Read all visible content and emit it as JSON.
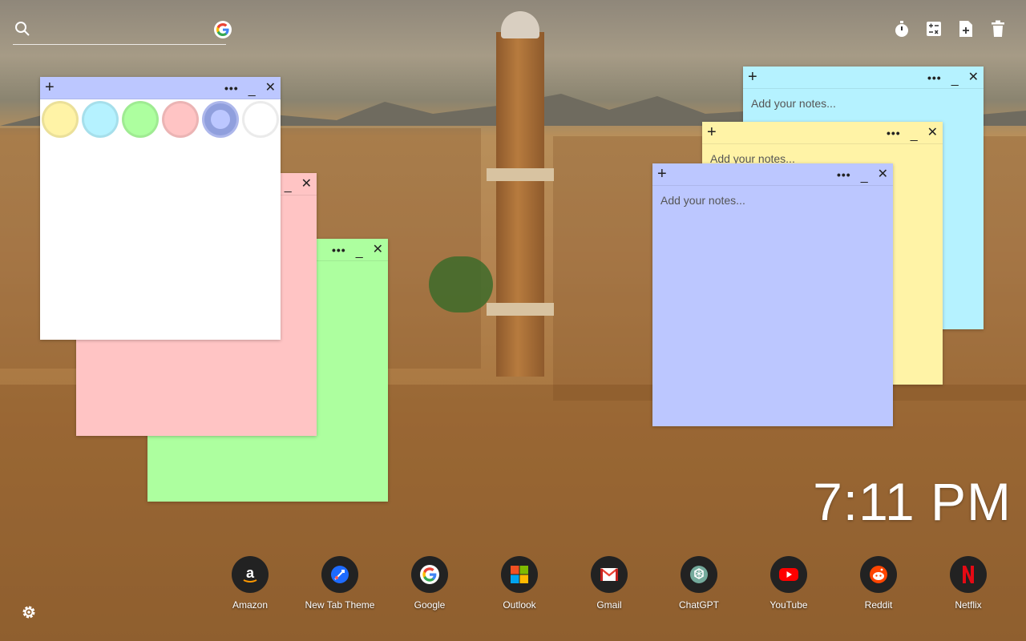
{
  "search": {
    "placeholder": ""
  },
  "tools": [
    "timer-icon",
    "calculator-icon",
    "new-document-icon",
    "trash-icon"
  ],
  "notes": {
    "placeholder": "Add your notes...",
    "plus": "+",
    "more": "•••",
    "minimize": "_",
    "close": "✕"
  },
  "swatches": [
    {
      "name": "yellow",
      "color": "#fff3a6"
    },
    {
      "name": "cyan",
      "color": "#b5f2ff"
    },
    {
      "name": "green",
      "color": "#adff9f"
    },
    {
      "name": "pink",
      "color": "#ffc4c4"
    },
    {
      "name": "blue",
      "color": "#bcc7ff"
    },
    {
      "name": "white",
      "color": "#ffffff"
    }
  ],
  "clock": {
    "time": "7:11 PM"
  },
  "dock": {
    "apps": [
      {
        "label": "Amazon",
        "icon": "amazon-icon"
      },
      {
        "label": "New Tab Theme",
        "icon": "new-tab-theme-icon"
      },
      {
        "label": "Google",
        "icon": "google-icon"
      },
      {
        "label": "Outlook",
        "icon": "outlook-icon"
      },
      {
        "label": "Gmail",
        "icon": "gmail-icon"
      },
      {
        "label": "ChatGPT",
        "icon": "chatgpt-icon"
      },
      {
        "label": "YouTube",
        "icon": "youtube-icon"
      },
      {
        "label": "Reddit",
        "icon": "reddit-icon"
      },
      {
        "label": "Netflix",
        "icon": "netflix-icon"
      }
    ]
  }
}
